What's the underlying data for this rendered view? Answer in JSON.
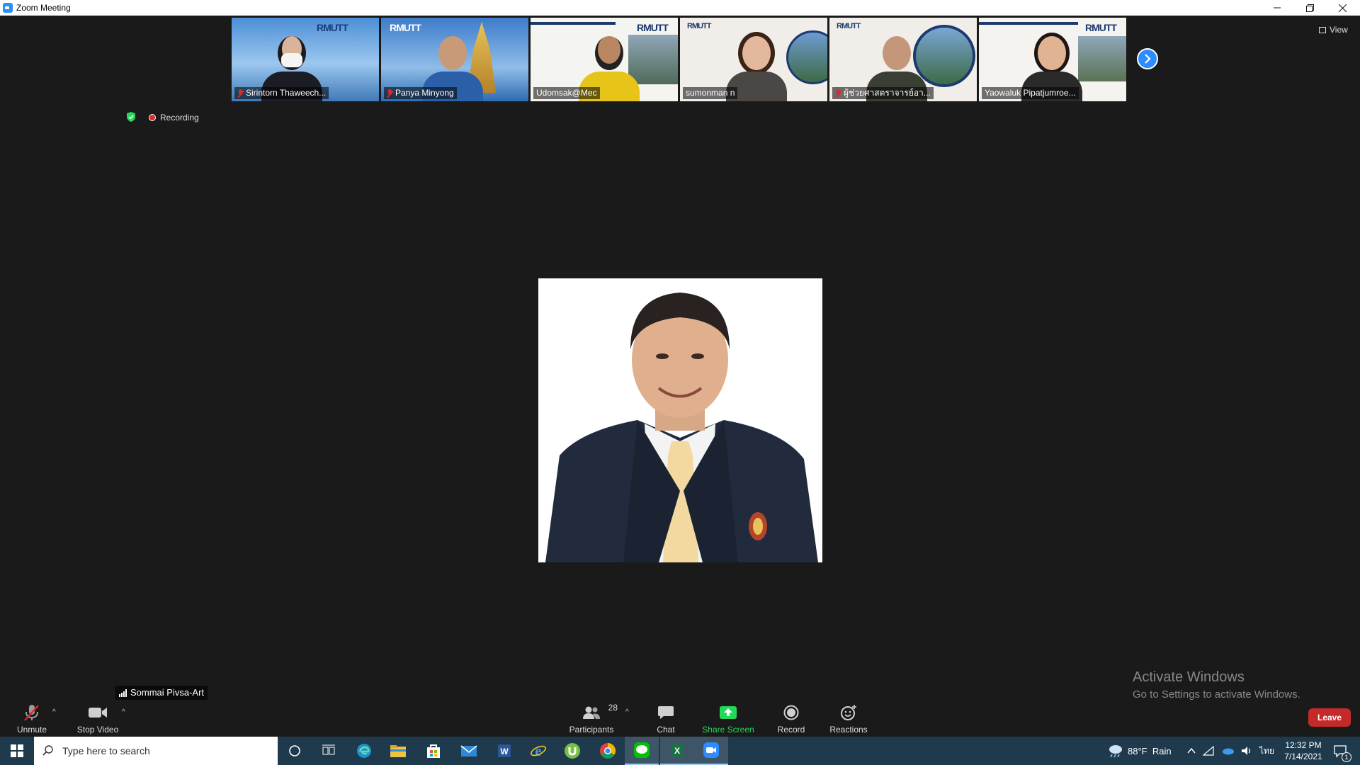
{
  "window": {
    "title": "Zoom Meeting"
  },
  "thumbnails": [
    {
      "name": "Sirintorn Thaweech...",
      "muted": true,
      "logo": "RMUTT"
    },
    {
      "name": "Panya Minyong",
      "muted": true,
      "logo": "RMUTT"
    },
    {
      "name": "Udomsak@Mec",
      "muted": false,
      "logo": "RMUTT"
    },
    {
      "name": "sumonman n",
      "muted": false,
      "logo": "RMUTT"
    },
    {
      "name": "ผู้ช่วยศาสตราจารย์อา...",
      "muted": true,
      "logo": "RMUTT"
    },
    {
      "name": "Yaowaluk Pipatjumroe...",
      "muted": false,
      "logo": "RMUTT"
    }
  ],
  "top_right": {
    "view_label": "View"
  },
  "status": {
    "recording_label": "Recording"
  },
  "active_speaker": {
    "name": "Sommai Pivsa-Art"
  },
  "watermark": {
    "line1": "Activate Windows",
    "line2": "Go to Settings to activate Windows."
  },
  "toolbar": {
    "unmute_label": "Unmute",
    "stop_video_label": "Stop Video",
    "participants_label": "Participants",
    "participants_count": "28",
    "chat_label": "Chat",
    "share_screen_label": "Share Screen",
    "record_label": "Record",
    "reactions_label": "Reactions",
    "leave_label": "Leave"
  },
  "taskbar": {
    "search_placeholder": "Type here to search",
    "weather": "88°F  Rain",
    "language": "ไทย",
    "time": "12:32 PM",
    "date": "7/14/2021",
    "notification_count": "1"
  },
  "colors": {
    "accent": "#2d8cff",
    "share_green": "#23d959",
    "leave_red": "#c52a2a",
    "background": "#1a1a1a",
    "taskbar": "#1f3a4d"
  }
}
